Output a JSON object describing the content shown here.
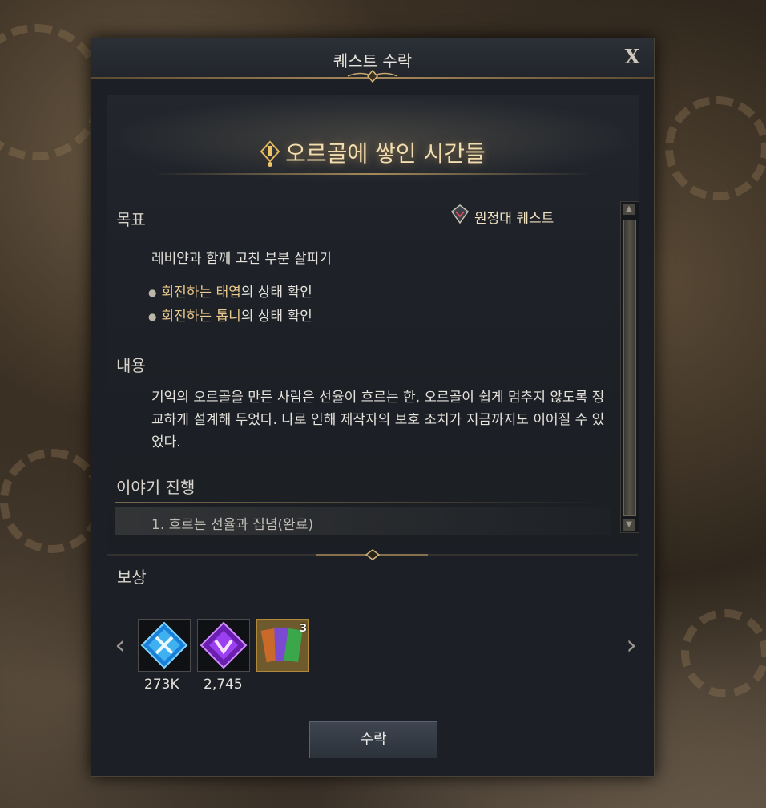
{
  "dialog": {
    "title": "퀘스트 수락",
    "close_label": "X"
  },
  "quest": {
    "name": "오르골에 쌓인 시간들",
    "type_label": "원정대 퀘스트"
  },
  "objective": {
    "label": "목표",
    "summary": "레비얀과 함께 고친 부분 살피기",
    "items": [
      {
        "highlight": "회전하는 태엽",
        "rest": "의 상태 확인"
      },
      {
        "highlight": "회전하는 톱니",
        "rest": "의 상태 확인"
      }
    ]
  },
  "content": {
    "label": "내용",
    "text": "기억의 오르골을 만든 사람은 선율이 흐르는 한, 오르골이 쉽게 멈추지 않도록 정교하게 설계해 두었다. 나로 인해 제작자의 보호 조치가 지금까지도 이어질 수 있었다."
  },
  "story": {
    "label": "이야기 진행",
    "steps": [
      "1. 흐르는 선율과 집념(완료)"
    ]
  },
  "rewards": {
    "label": "보상",
    "items": [
      {
        "icon": "crossed-swords-gem-icon",
        "count": "273K"
      },
      {
        "icon": "purple-crest-gem-icon",
        "count": "2,745"
      },
      {
        "icon": "card-pack-icon",
        "stack": "3"
      }
    ]
  },
  "accept_button": "수락",
  "colors": {
    "highlight": "#eac98e",
    "title_gold": "#f2ddb0",
    "panel": "#1c2026"
  }
}
